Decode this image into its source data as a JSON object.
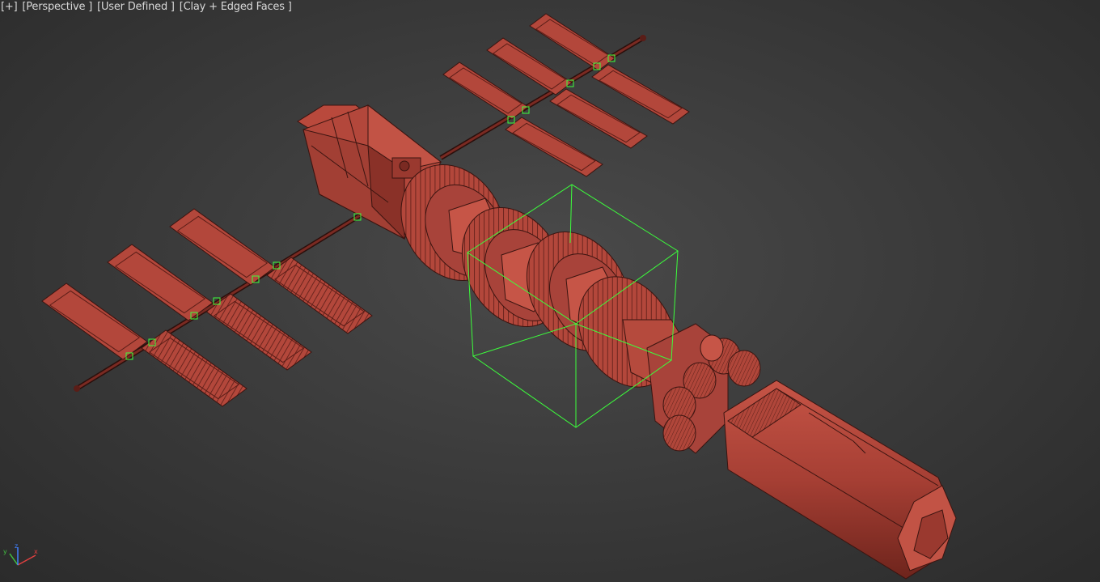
{
  "viewport": {
    "menus": [
      {
        "name": "viewport-menu-plus",
        "label": "[+]"
      },
      {
        "name": "viewport-menu-view",
        "label": "[Perspective ]"
      },
      {
        "name": "viewport-menu-preset",
        "label": "[User Defined ]"
      },
      {
        "name": "viewport-menu-shading",
        "label": "[Clay + Edged Faces ]"
      }
    ],
    "axis": {
      "x": "x",
      "y": "y",
      "z": "z"
    },
    "colors": {
      "background": "#3c3c3c",
      "model_fill": "#b3473b",
      "model_edge": "#3a1410",
      "selection_box": "#3cff3c",
      "axis_x": "#e04040",
      "axis_y": "#40c040",
      "axis_z": "#4080ff"
    }
  }
}
